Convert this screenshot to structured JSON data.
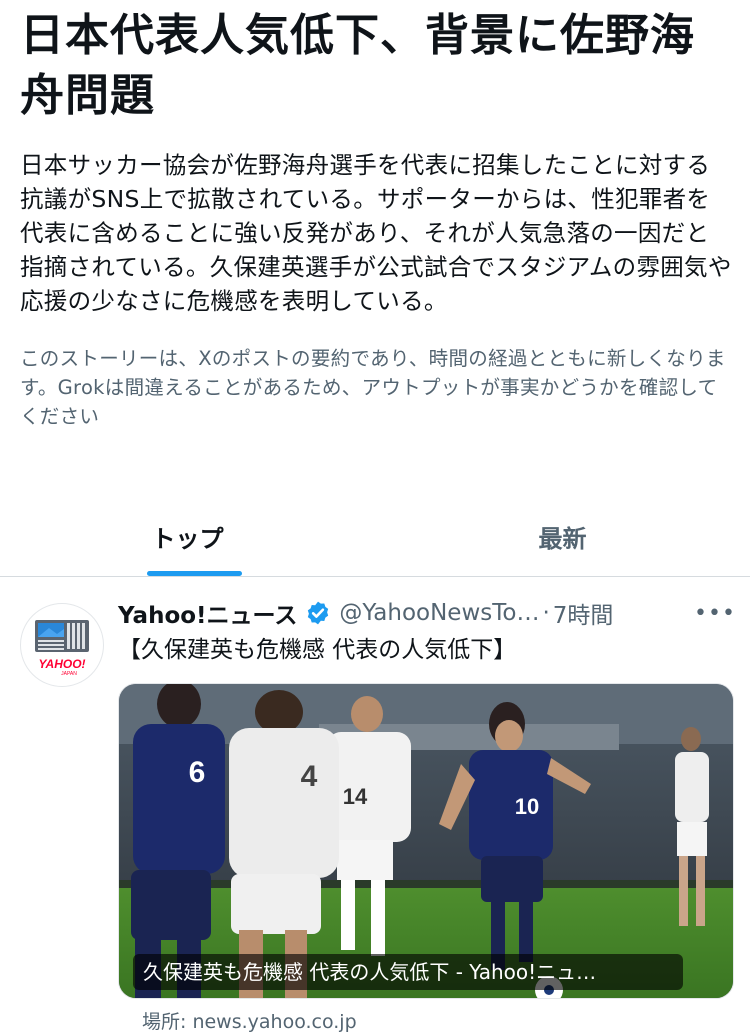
{
  "story": {
    "headline": "日本代表人気低下、背景に佐野海舟問題",
    "summary": "日本サッカー協会が佐野海舟選手を代表に招集したことに対する抗議がSNS上で拡散されている。サポーターからは、性犯罪者を代表に含めることに強い反発があり、それが人気急落の一因だと指摘されている。久保建英選手が公式試合でスタジアムの雰囲気や応援の少なさに危機感を表明している。",
    "disclaimer": "このストーリーは、Xのポストの要約であり、時間の経過とともに新しくなります。Grokは間違えることがあるため、アウトプットが事実かどうかを確認してください"
  },
  "tabs": [
    {
      "label": "トップ",
      "active": true
    },
    {
      "label": "最新",
      "active": false
    }
  ],
  "post": {
    "author": "Yahoo!ニュース",
    "handle": "@YahooNewsTo…",
    "separator": "·",
    "time": "7時間",
    "text": "【久保建英も危機感 代表の人気低下】",
    "avatar_logo": "YAHOO!",
    "avatar_logo_sub": "JAPAN",
    "media_caption": "久保建英も危機感 代表の人気低下 - Yahoo!ニュ…",
    "source_label": "場所: news.yahoo.co.jp",
    "verified_icon": "verified-badge-icon",
    "more_icon": "more-dots-icon"
  },
  "colors": {
    "accent": "#1d9bf0",
    "text_primary": "#0f1419",
    "text_secondary": "#536471",
    "japan_blue": "#1c2a6b",
    "yahoo_red": "#ff0033"
  }
}
